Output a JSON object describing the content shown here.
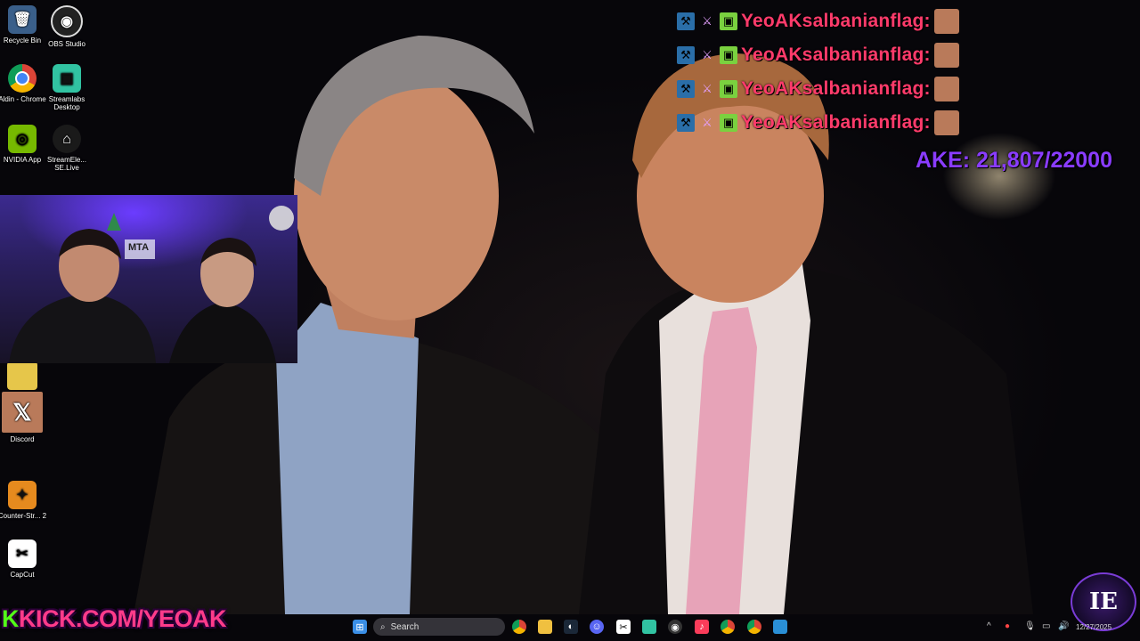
{
  "desktop": {
    "icons": [
      {
        "label": "Recycle Bin",
        "icon": "recycle-bin-icon"
      },
      {
        "label": "OBS Studio",
        "icon": "obs-icon"
      },
      {
        "label": "Aldin - Chrome",
        "icon": "chrome-icon"
      },
      {
        "label": "Streamlabs Desktop",
        "icon": "streamlabs-icon"
      },
      {
        "label": "NVIDIA App",
        "icon": "nvidia-icon"
      },
      {
        "label": "StreamEle... SE.Live",
        "icon": "streamelements-icon"
      },
      {
        "label": "Discord",
        "icon": "discord-icon"
      },
      {
        "label": "Counter-Str... 2",
        "icon": "counter-strike-icon"
      },
      {
        "label": "CapCut",
        "icon": "capcut-icon"
      }
    ]
  },
  "chat": {
    "messages": [
      {
        "username": "YeoAKsalbanianflag:"
      },
      {
        "username": "YeoAKsalbanianflag:"
      },
      {
        "username": "YeoAKsalbanianflag:"
      },
      {
        "username": "YeoAKsalbanianflag:"
      }
    ],
    "name_color": "#ff3b6b"
  },
  "goal": {
    "text": "AKE: 21,807/22000",
    "color": "#8a3cff"
  },
  "webcam": {
    "sign": "MTA"
  },
  "banner": {
    "text": "KICK.COM/YEOAK",
    "prefix": "K"
  },
  "taskbar": {
    "search_placeholder": "Search",
    "clock_date": "12/27/2025"
  },
  "overlay_badge": {
    "text": "IE"
  }
}
